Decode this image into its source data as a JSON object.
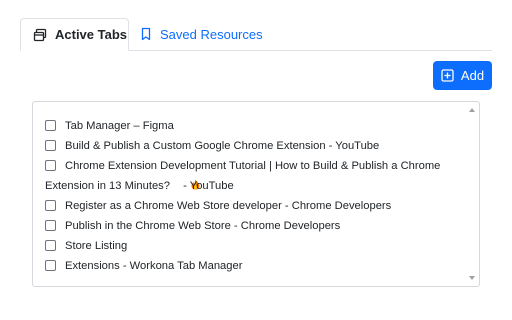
{
  "tabs": {
    "active_label": "Active Tabs",
    "saved_label": "Saved Resources"
  },
  "add_button": {
    "label": "Add"
  },
  "list": {
    "items": [
      {
        "title": "Tab Manager – Figma"
      },
      {
        "title": "Build & Publish a Custom Google Chrome Extension - YouTube"
      },
      {
        "title": "Chrome Extension Development Tutorial | How to Build & Publish a Chrome Extension in 13 Minutes?",
        "suffix": " - YouTube",
        "emoji": "fire-icon"
      },
      {
        "title": "Register as a Chrome Web Store developer - Chrome Developers"
      },
      {
        "title": "Publish in the Chrome Web Store - Chrome Developers"
      },
      {
        "title": "Store Listing"
      },
      {
        "title": "Extensions - Workona Tab Manager"
      }
    ]
  },
  "colors": {
    "accent": "#0d6efd",
    "border": "#dee2e6",
    "text": "#212529"
  }
}
